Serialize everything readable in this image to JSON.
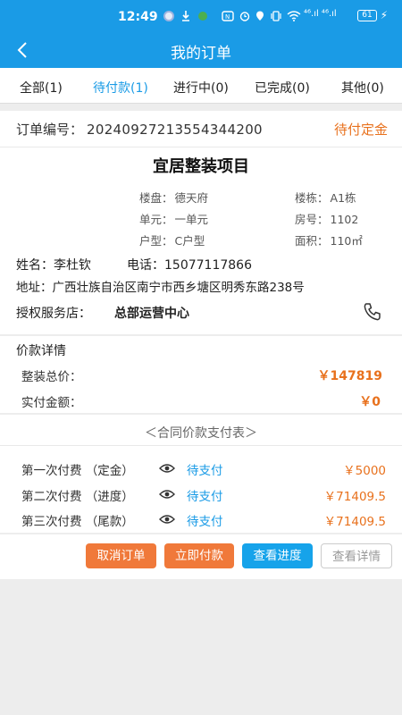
{
  "statusbar": {
    "time": "12:49",
    "battery": "61",
    "signal_text": "⁴⁶.ıl ⁴⁶.ıl"
  },
  "header": {
    "title": "我的订单",
    "back_icon": "chevron-left-icon"
  },
  "tabs": [
    {
      "label": "全部(1)",
      "active": false
    },
    {
      "label": "待付款(1)",
      "active": true
    },
    {
      "label": "进行中(0)",
      "active": false
    },
    {
      "label": "已完成(0)",
      "active": false
    },
    {
      "label": "其他(0)",
      "active": false
    }
  ],
  "order": {
    "number_label": "订单编号：",
    "number": "20240927213554344200",
    "status": "待付定金",
    "project_title": "宜居整装项目",
    "details": {
      "estate_label": "楼盘：",
      "estate": "德天府",
      "building_label": "楼栋：",
      "building": "A1栋",
      "unit_label": "单元：",
      "unit": "一单元",
      "room_label": "房号：",
      "room": "1102",
      "layout_label": "户型：",
      "layout": "C户型",
      "area_label": "面积：",
      "area": "110㎡"
    },
    "name_label": "姓名：",
    "name": "李杜钦",
    "phone_label": "电话：",
    "phone": "15077117866",
    "address_label": "地址：",
    "address": "广西壮族自治区南宁市西乡塘区明秀东路238号",
    "store_label": "授权服务店：",
    "store": "总部运营中心",
    "phone_icon": "phone-icon"
  },
  "price": {
    "heading": "价款详情",
    "total_label": "整装总价：",
    "total": "￥147819",
    "paid_label": "实付金额：",
    "paid": "￥0"
  },
  "contract": {
    "title": "＜合同价款支付表＞",
    "payments": [
      {
        "label": "第一次付费 （定金）",
        "status": "待支付",
        "amount": "￥5000"
      },
      {
        "label": "第二次付费 （进度）",
        "status": "待支付",
        "amount": "￥71409.5"
      },
      {
        "label": "第三次付费 （尾款）",
        "status": "待支付",
        "amount": "￥71409.5"
      }
    ]
  },
  "actions": {
    "cancel": "取消订单",
    "pay": "立即付款",
    "progress": "查看进度",
    "detail": "查看详情"
  },
  "colors": {
    "primary": "#1a9be6",
    "orange": "#e8711d",
    "button_orange": "#f0793a"
  }
}
